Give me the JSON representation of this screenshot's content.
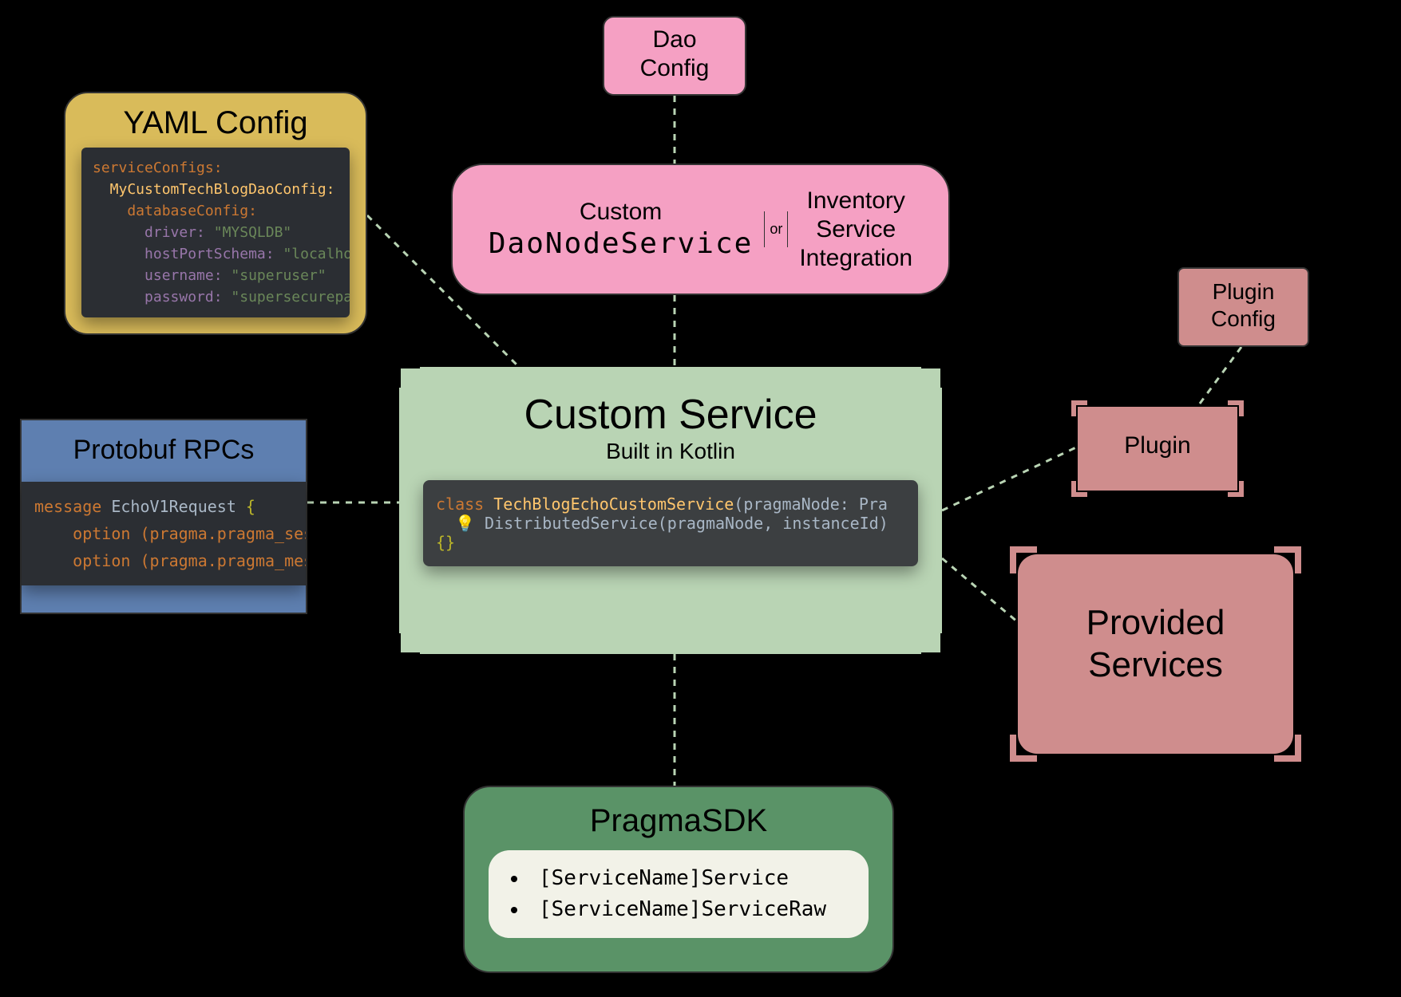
{
  "yaml": {
    "title": "YAML Config",
    "code_lines": [
      {
        "text": "serviceConfigs:",
        "cls": "kw-orange"
      },
      {
        "text": "  MyCustomTechBlogDaoConfig:",
        "cls": "kw-yellow"
      },
      {
        "text": "    databaseConfig:",
        "cls": "kw-orange"
      },
      {
        "text": "      driver: \"MYSQLDB\"",
        "cls": "mix-dh"
      },
      {
        "text": "      hostPortSchema: \"localho",
        "cls": "mix-hp"
      },
      {
        "text": "      username: \"superuser\"",
        "cls": "mix-un"
      },
      {
        "text": "      password: \"supersecurepa",
        "cls": "mix-pw"
      }
    ]
  },
  "dao_config": {
    "l1": "Dao",
    "l2": "Config"
  },
  "dao_node": {
    "left_l1": "Custom",
    "left_l2": "DaoNodeService",
    "or": "or",
    "right_l1": "Inventory",
    "right_l2": "Service",
    "right_l3": "Integration"
  },
  "proto": {
    "title": "Protobuf RPCs",
    "lines": [
      "message EchoV1Request {",
      "    option (pragma.pragma_ses",
      "    option (pragma.pragma_mes"
    ]
  },
  "custom_service": {
    "title": "Custom Service",
    "subtitle": "Built in Kotlin",
    "code": [
      "class TechBlogEchoCustomService(pragmaNode: Pra",
      "  💡 DistributedService(pragmaNode, instanceId)",
      "{}"
    ]
  },
  "plugin_config": {
    "l1": "Plugin",
    "l2": "Config"
  },
  "plugin": {
    "label": "Plugin"
  },
  "provided": {
    "l1": "Provided",
    "l2": "Services"
  },
  "sdk": {
    "title": "PragmaSDK",
    "items": [
      "[ServiceName]Service",
      "[ServiceName]ServiceRaw"
    ]
  }
}
